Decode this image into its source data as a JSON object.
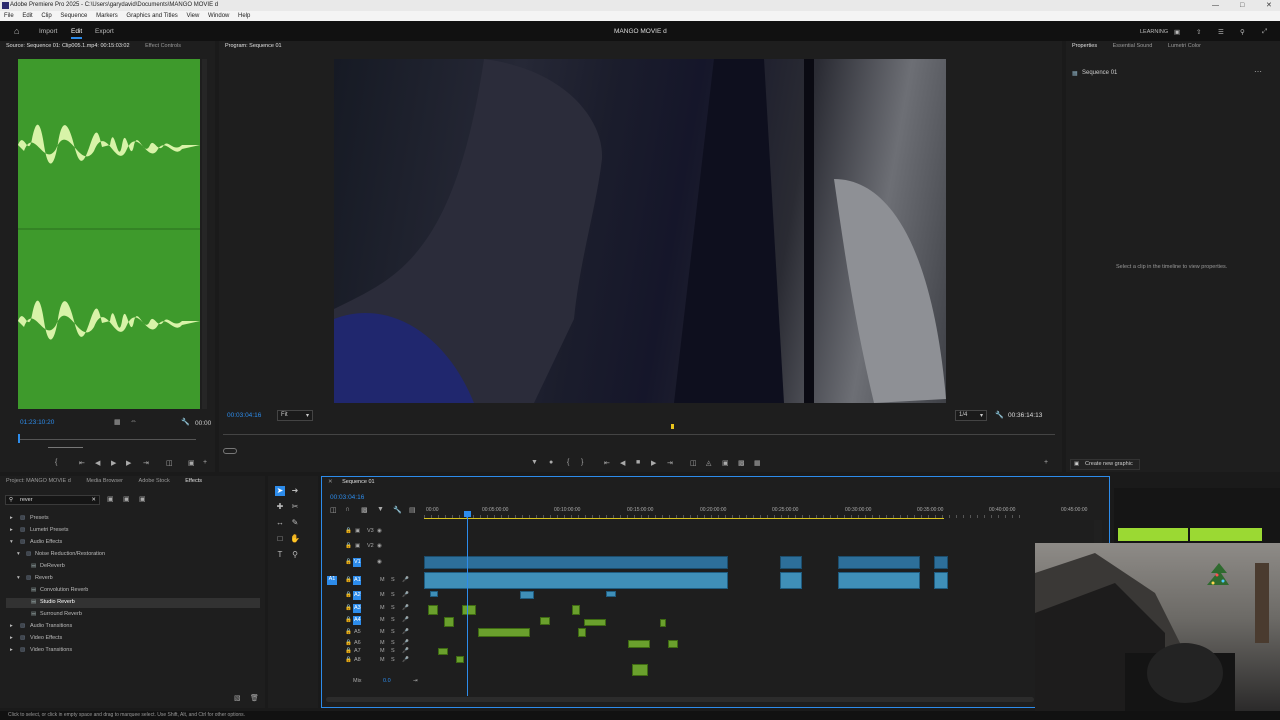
{
  "titlebar": {
    "title": "Adobe Premiere Pro 2025 - C:\\Users\\garydavid\\Documents\\MANGO MOVIE d"
  },
  "menubar": {
    "items": [
      "File",
      "Edit",
      "Clip",
      "Sequence",
      "Markers",
      "Graphics and Titles",
      "View",
      "Window",
      "Help"
    ]
  },
  "header": {
    "tabs": [
      "Import",
      "Edit",
      "Export"
    ],
    "active_tab": "Edit",
    "project_title": "MANGO MOVIE d",
    "learning": "LEARNING"
  },
  "source": {
    "tab_label": "Source: Sequence 01: Clip005.1.mp4: 00:15:03:02",
    "effect_controls": "Effect Controls",
    "timecode": "01:23:10:20",
    "timecode_right": "00:00"
  },
  "program": {
    "tab_label": "Program: Sequence 01",
    "timecode": "00:03:04:16",
    "fit": "Fit",
    "resolution": "1/4",
    "duration": "00:36:14:13"
  },
  "properties": {
    "tabs": [
      "Properties",
      "Essential Sound",
      "Lumetri Color"
    ],
    "sequence": "Sequence 01",
    "hint": "Select a clip in the timeline to view properties.",
    "create_graphic": "Create new graphic"
  },
  "project_panel": {
    "tabs": [
      "Project: MANGO MOVIE d",
      "Media Browser",
      "Adobe Stock",
      "Effects"
    ],
    "search": "rever",
    "tree": [
      {
        "label": "Presets",
        "level": 0
      },
      {
        "label": "Lumetri Presets",
        "level": 0
      },
      {
        "label": "Audio Effects",
        "level": 0
      },
      {
        "label": "Noise Reduction/Restoration",
        "level": 1
      },
      {
        "label": "DeReverb",
        "level": 2
      },
      {
        "label": "Reverb",
        "level": 1
      },
      {
        "label": "Convolution Reverb",
        "level": 2
      },
      {
        "label": "Studio Reverb",
        "level": 2,
        "selected": true
      },
      {
        "label": "Surround Reverb",
        "level": 2
      },
      {
        "label": "Audio Transitions",
        "level": 0
      },
      {
        "label": "Video Effects",
        "level": 0
      },
      {
        "label": "Video Transitions",
        "level": 0
      }
    ]
  },
  "timeline": {
    "tab_label": "Sequence 01",
    "timecode": "00:03:04:16",
    "ruler": [
      "00:00",
      "00:05:00:00",
      "00:10:00:00",
      "00:15:00:00",
      "00:20:00:00",
      "00:25:00:00",
      "00:30:00:00",
      "00:35:00:00",
      "00:40:00:00",
      "00:45:00:00"
    ],
    "video_tracks": [
      "V3",
      "V2",
      "V1"
    ],
    "audio_tracks": [
      "A1",
      "A2",
      "A3",
      "A4",
      "A5",
      "A6",
      "A7",
      "A8"
    ],
    "mix": "Mix",
    "mix_value": "0.0"
  },
  "status": "Click to select, or click in empty space and drag to marquee select. Use Shift, Alt, and Ctrl for other options.",
  "colors": {
    "accent": "#2d8ceb",
    "waveform": "#3e9a2c",
    "clip_video": "#2d6f9a",
    "clip_audio": "#3f8fb8",
    "clip_green": "#6aa02d"
  }
}
